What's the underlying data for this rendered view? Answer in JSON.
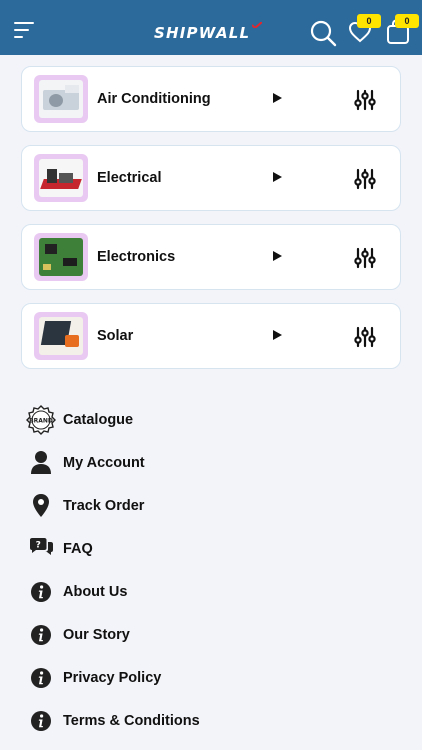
{
  "header": {
    "logo_text": "SHIPWALL",
    "wishlist_count": "0",
    "cart_count": "0",
    "bar_color": "#2b6a9b",
    "badge_color": "#ffe400"
  },
  "categories": [
    {
      "label": "Air Conditioning",
      "thumb_icon": "air-conditioner-image"
    },
    {
      "label": "Electrical",
      "thumb_icon": "electrical-tools-image"
    },
    {
      "label": "Electronics",
      "thumb_icon": "circuit-board-image"
    },
    {
      "label": "Solar",
      "thumb_icon": "solar-panel-image"
    }
  ],
  "menu": [
    {
      "label": "Catalogue",
      "icon": "brand-badge-icon"
    },
    {
      "label": "My Account",
      "icon": "user-icon"
    },
    {
      "label": "Track Order",
      "icon": "location-pin-icon"
    },
    {
      "label": "FAQ",
      "icon": "faq-chat-icon"
    },
    {
      "label": "About Us",
      "icon": "info-icon"
    },
    {
      "label": "Our Story",
      "icon": "info-icon"
    },
    {
      "label": "Privacy Policy",
      "icon": "info-icon"
    },
    {
      "label": "Terms & Conditions",
      "icon": "info-icon"
    }
  ]
}
